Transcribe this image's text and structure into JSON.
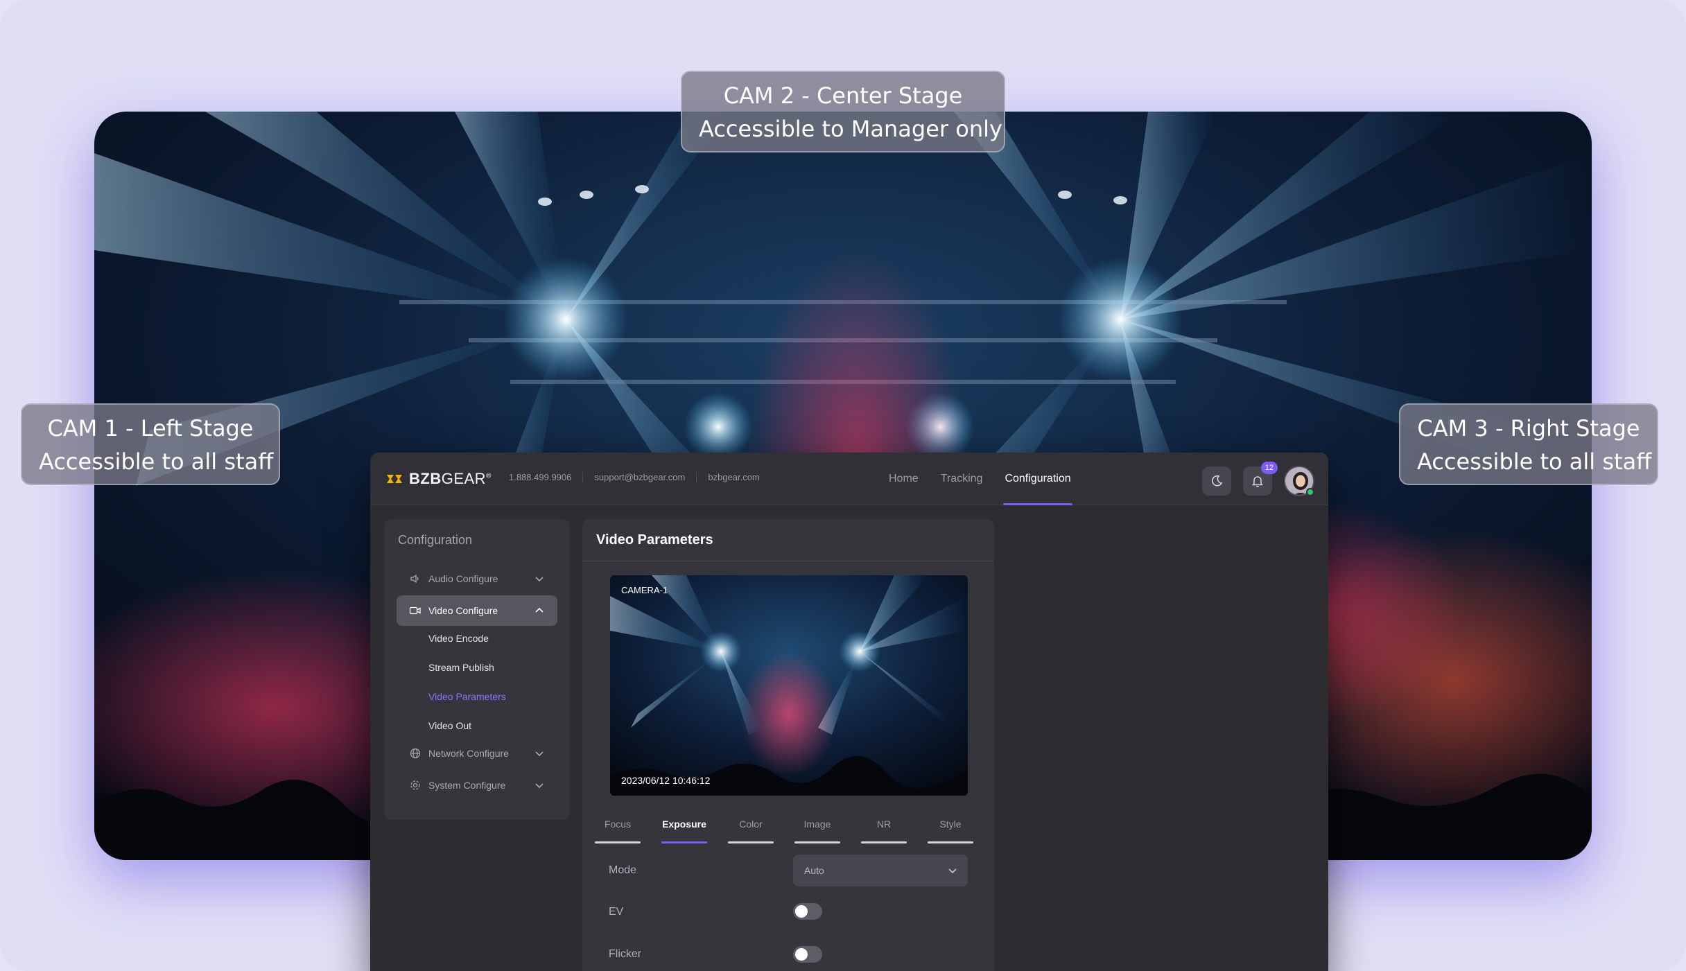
{
  "callouts": {
    "cam2": {
      "line1": "CAM 2 - Center Stage",
      "line2": "Accessible to Manager only"
    },
    "cam1": {
      "line1": "CAM 1 - Left Stage",
      "line2": "Accessible to all staff"
    },
    "cam3": {
      "line1": "CAM 3 - Right Stage",
      "line2": "Accessible to all staff"
    }
  },
  "header": {
    "logo_text_bold": "BZB",
    "logo_text_rest": "GEAR",
    "logo_reg": "®",
    "phone": "1.888.499.9906",
    "email": "support@bzbgear.com",
    "website": "bzbgear.com",
    "nav": [
      {
        "label": "Home"
      },
      {
        "label": "Tracking"
      },
      {
        "label": "Configuration",
        "active": true
      }
    ],
    "notification_count": "12"
  },
  "sidebar": {
    "title": "Configuration",
    "items": [
      {
        "label": "Audio Configure",
        "icon": "speaker-icon"
      },
      {
        "label": "Video Configure",
        "icon": "video-camera-icon",
        "expanded": true
      },
      {
        "label": "Network Configure",
        "icon": "globe-icon"
      },
      {
        "label": "System Configure",
        "icon": "gear-icon"
      }
    ],
    "subitems": [
      {
        "label": "Video Encode"
      },
      {
        "label": "Stream Publish"
      },
      {
        "label": "Video Parameters",
        "active": true
      },
      {
        "label": "Video Out"
      }
    ]
  },
  "panel": {
    "title": "Video Parameters",
    "camera_name": "CAMERA-1",
    "timestamp": "2023/06/12  10:46:12",
    "tabs": [
      "Focus",
      "Exposure",
      "Color",
      "Image",
      "NR",
      "Style"
    ],
    "active_tab": "Exposure",
    "fields": {
      "mode_label": "Mode",
      "mode_value": "Auto",
      "ev_label": "EV",
      "ev_on": false,
      "flicker_label": "Flicker",
      "flicker_on": false
    }
  },
  "colors": {
    "accent": "#7c5cf2",
    "background": "#e3e2f6",
    "app_bg": "#2c2c31",
    "panel_bg": "#35353b"
  }
}
